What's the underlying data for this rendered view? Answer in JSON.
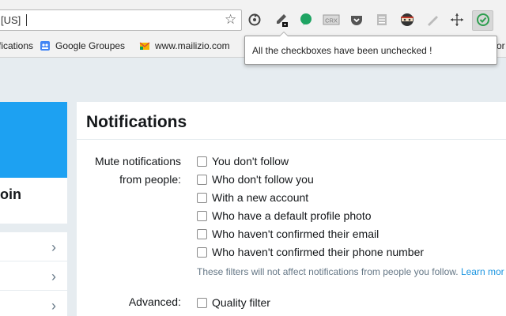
{
  "browser": {
    "omnibox_text": "[US]",
    "tooltip_text": "All the checkboxes have been unchecked !",
    "extensions": [
      "sync-icon",
      "eyedropper-icon",
      "green-leaf-icon",
      "crx-icon",
      "pocket-icon",
      "page-icon",
      "ninja-mask-icon",
      "pencil-icon",
      "move-arrows-icon",
      "check-circle-icon"
    ],
    "crx_label": "CRX"
  },
  "bookmarks": [
    {
      "label": "fications",
      "icon": "none"
    },
    {
      "label": "Google Groupes",
      "icon": "groups-icon"
    },
    {
      "label": "www.mailizio.com",
      "icon": "envelope-icon"
    },
    {
      "label": "vor",
      "icon": "none"
    }
  ],
  "profile": {
    "name": "oin"
  },
  "nav": {
    "chevron": "›"
  },
  "settings": {
    "title": "Notifications",
    "mute_label_line1": "Mute notifications",
    "mute_label_line2": "from people:",
    "options": [
      {
        "label": "You don't follow",
        "checked": false
      },
      {
        "label": "Who don't follow you",
        "checked": false
      },
      {
        "label": "With a new account",
        "checked": false
      },
      {
        "label": "Who have a default profile photo",
        "checked": false
      },
      {
        "label": "Who haven't confirmed their email",
        "checked": false
      },
      {
        "label": "Who haven't confirmed their phone number",
        "checked": false
      }
    ],
    "hint_text": "These filters will not affect notifications from people you follow.",
    "hint_link": "Learn mor",
    "advanced_label": "Advanced:",
    "quality_filter_label": "Quality filter",
    "quality_filter_checked": false
  },
  "colors": {
    "accent": "#1da1f2",
    "link": "#1b95e0",
    "page_bg": "#e6ecf0"
  }
}
